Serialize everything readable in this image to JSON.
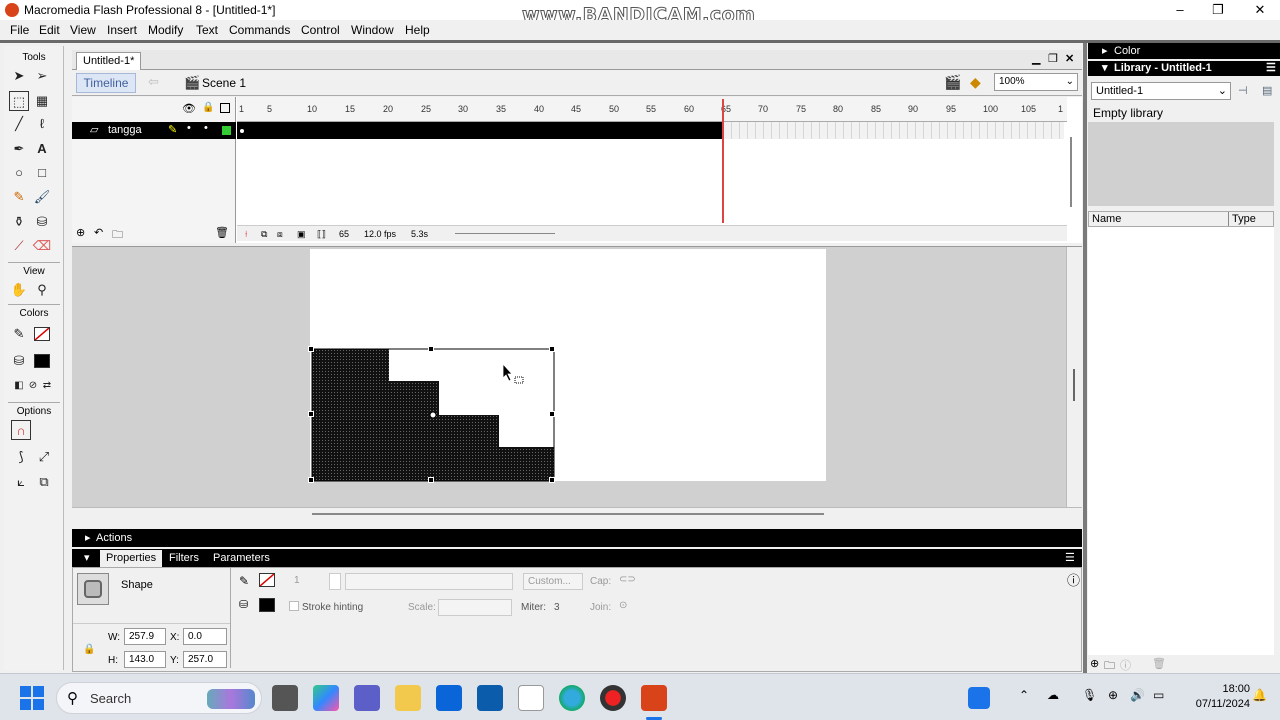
{
  "window": {
    "title": "Macromedia Flash Professional 8 - [Untitled-1*]",
    "watermark": "www.BANDICAM.com",
    "minimize": "–",
    "maximize": "❐",
    "close": "✕"
  },
  "menu": [
    "File",
    "Edit",
    "View",
    "Insert",
    "Modify",
    "Text",
    "Commands",
    "Control",
    "Window",
    "Help"
  ],
  "tools": {
    "header": "Tools",
    "view_label": "View",
    "colors_label": "Colors",
    "options_label": "Options"
  },
  "document": {
    "tab": "Untitled-1*",
    "timeline_button": "Timeline",
    "scene": "Scene 1",
    "zoom": "100%"
  },
  "timeline": {
    "layer_name": "tangga",
    "ruler": [
      "1",
      "5",
      "10",
      "15",
      "20",
      "25",
      "30",
      "35",
      "40",
      "45",
      "50",
      "55",
      "60",
      "65",
      "70",
      "75",
      "80",
      "85",
      "90",
      "95",
      "100",
      "105",
      "1"
    ],
    "current_frame": "65",
    "fps": "12.0 fps",
    "time": "5.3s"
  },
  "panels": {
    "actions": "Actions",
    "properties_tab": "Properties",
    "filters_tab": "Filters",
    "parameters_tab": "Parameters"
  },
  "properties": {
    "type": "Shape",
    "stroke_height": "1",
    "custom_button": "Custom...",
    "cap_label": "Cap:",
    "join_label": "Join:",
    "stroke_hinting": "Stroke hinting",
    "scale_label": "Scale:",
    "miter_label": "Miter:",
    "miter_value": "3",
    "w_label": "W:",
    "w_value": "257.9",
    "h_label": "H:",
    "h_value": "143.0",
    "x_label": "X:",
    "x_value": "0.0",
    "y_label": "Y:",
    "y_value": "257.0"
  },
  "library": {
    "color_header": "Color",
    "header": "Library - Untitled-1",
    "selector": "Untitled-1",
    "empty_text": "Empty library",
    "col_name": "Name",
    "col_type": "Type"
  },
  "taskbar": {
    "search": "Search",
    "time": "18:00",
    "date": "07/11/2024"
  },
  "colors": {
    "accent": "#4060a0",
    "playhead": "#dd4444",
    "selection": "#000000"
  }
}
